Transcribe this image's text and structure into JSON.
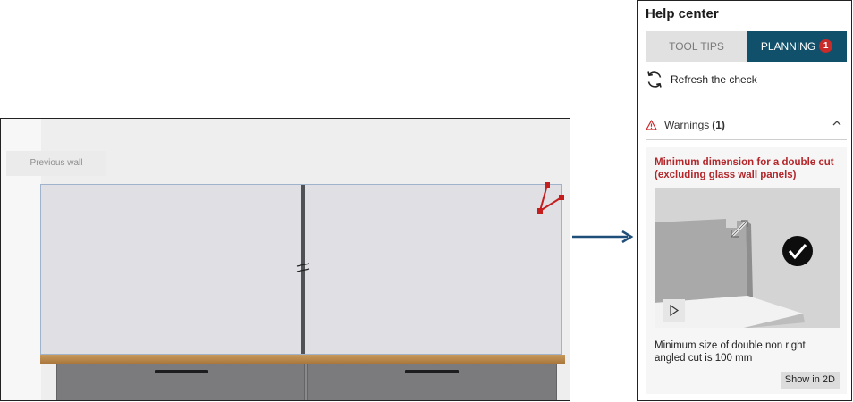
{
  "canvas": {
    "previous_wall_label": "Previous wall"
  },
  "help_center": {
    "title": "Help center",
    "tabs": [
      {
        "label": "TOOL TIPS",
        "active": false
      },
      {
        "label": "PLANNING",
        "active": true,
        "badge": "1"
      }
    ],
    "refresh_label": "Refresh the check",
    "warnings": {
      "label": "Warnings",
      "count": "(1)",
      "expanded": true
    },
    "card": {
      "title": "Minimum dimension for a double cut (excluding glass wall panels)",
      "description": "Minimum size of double non right angled cut is 100 mm",
      "show_2d_label": "Show in 2D"
    }
  },
  "colors": {
    "active_tab": "#11506a",
    "warning_red": "#b3262a",
    "badge_red": "#c92a2a",
    "arrow_blue": "#1f4e79"
  },
  "icons": {
    "refresh": "refresh-icon",
    "warning": "warning-triangle-icon",
    "collapse": "chevron-up-icon",
    "check": "checkmark-circle-icon",
    "play": "play-icon"
  }
}
